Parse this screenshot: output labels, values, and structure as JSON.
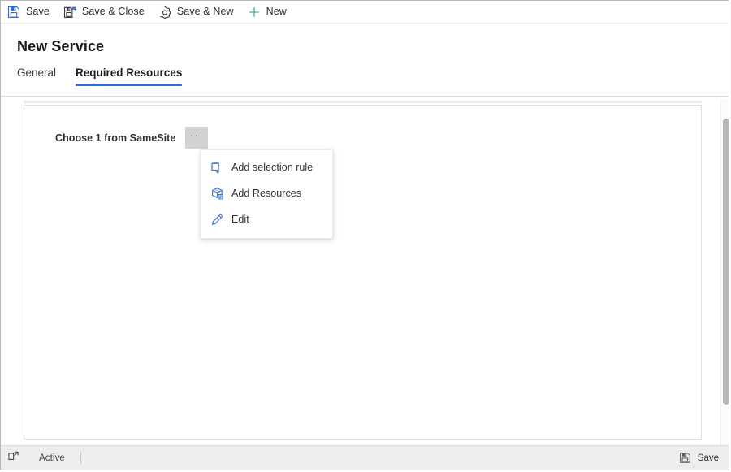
{
  "commandbar": {
    "buttons": [
      {
        "label": "Save",
        "icon": "save-icon"
      },
      {
        "label": "Save & Close",
        "icon": "save-and-close-icon"
      },
      {
        "label": "Save & New",
        "icon": "save-and-new-icon"
      },
      {
        "label": "New",
        "icon": "plus-icon"
      }
    ]
  },
  "header": {
    "title": "New Service",
    "tabs": [
      {
        "label": "General",
        "active": false
      },
      {
        "label": "Required Resources",
        "active": true
      }
    ]
  },
  "content": {
    "field_label": "Choose 1 from SameSite",
    "ellipsis_button": {
      "label": "···",
      "name": "more-commands-button"
    },
    "menu": {
      "items": [
        {
          "label": "Add selection rule",
          "icon": "add-selection-rule-icon"
        },
        {
          "label": "Add Resources",
          "icon": "add-resources-icon"
        },
        {
          "label": "Edit",
          "icon": "pencil-icon"
        }
      ]
    }
  },
  "statusbar": {
    "popout_icon": "popout-icon",
    "status": "Active",
    "save": {
      "label": "Save",
      "icon": "save-icon-gray"
    }
  },
  "colors": {
    "accent_blue": "#2a6dd4",
    "icon_blue": "#3b79d0",
    "new_green": "#4caf7d",
    "text_primary": "#323130",
    "panel_border": "#e1e1e1",
    "statusbar_bg": "#ededed",
    "ellipsis_bg": "#d2d2d2"
  }
}
